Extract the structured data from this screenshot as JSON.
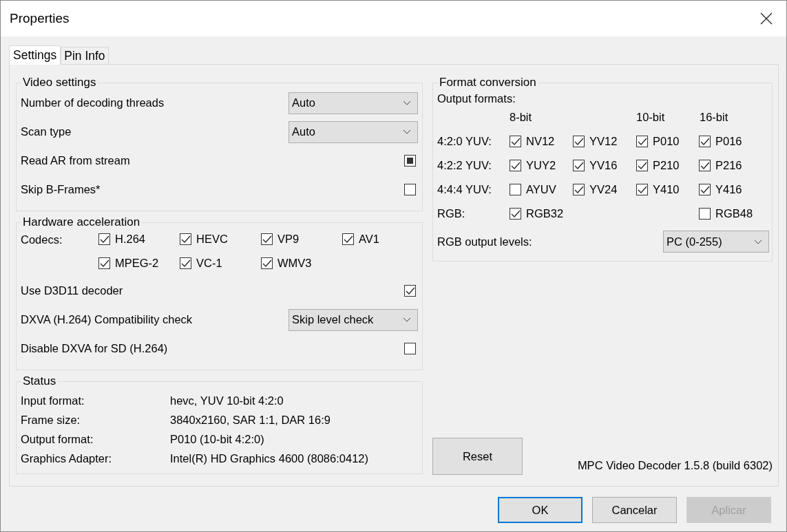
{
  "window": {
    "title": "Properties"
  },
  "tabs": [
    {
      "label": "Settings",
      "selected": true
    },
    {
      "label": "Pin Info",
      "selected": false
    }
  ],
  "video_settings": {
    "title": "Video settings",
    "rows": [
      {
        "kind": "dropdown",
        "label": "Number of decoding threads",
        "value": "Auto"
      },
      {
        "kind": "dropdown",
        "label": "Scan type",
        "value": "Auto"
      },
      {
        "kind": "checkbox",
        "label": "Read AR from stream",
        "checked": false,
        "indeterminate": true
      },
      {
        "kind": "checkbox",
        "label": "Skip B-Frames*",
        "checked": false,
        "indeterminate": false
      }
    ]
  },
  "hardware_acceleration": {
    "title": "Hardware acceleration",
    "codecs_label": "Codecs:",
    "codecs": [
      {
        "label": "H.264",
        "checked": true
      },
      {
        "label": "HEVC",
        "checked": true
      },
      {
        "label": "VP9",
        "checked": true
      },
      {
        "label": "AV1",
        "checked": true
      },
      {
        "label": "MPEG-2",
        "checked": true
      },
      {
        "label": "VC-1",
        "checked": true
      },
      {
        "label": "WMV3",
        "checked": true
      }
    ],
    "rows": [
      {
        "kind": "checkbox",
        "label": "Use D3D11 decoder",
        "checked": true
      },
      {
        "kind": "dropdown",
        "label": "DXVA (H.264) Compatibility check",
        "value": "Skip level check"
      },
      {
        "kind": "checkbox",
        "label": "Disable DXVA for SD (H.264)",
        "checked": false
      }
    ]
  },
  "status": {
    "title": "Status",
    "rows": [
      {
        "label": "Input format:",
        "value": "hevc, YUV 10-bit 4:2:0"
      },
      {
        "label": "Frame size:",
        "value": "3840x2160, SAR 1:1, DAR 16:9"
      },
      {
        "label": "Output format:",
        "value": "P010 (10-bit 4:2:0)"
      },
      {
        "label": "Graphics Adapter:",
        "value": "Intel(R) HD Graphics 4600 (8086:0412)"
      }
    ]
  },
  "format_conversion": {
    "title": "Format conversion",
    "output_formats_label": "Output formats:",
    "column_headers": [
      "8-bit",
      "10-bit",
      "16-bit"
    ],
    "rows": [
      {
        "label": "4:2:0 YUV:",
        "cells": [
          {
            "label": "NV12",
            "checked": true
          },
          {
            "label": "YV12",
            "checked": true
          },
          {
            "label": "P010",
            "checked": true
          },
          {
            "label": "P016",
            "checked": true
          }
        ]
      },
      {
        "label": "4:2:2 YUV:",
        "cells": [
          {
            "label": "YUY2",
            "checked": true
          },
          {
            "label": "YV16",
            "checked": true
          },
          {
            "label": "P210",
            "checked": true
          },
          {
            "label": "P216",
            "checked": true
          }
        ]
      },
      {
        "label": "4:4:4 YUV:",
        "cells": [
          {
            "label": "AYUV",
            "checked": false
          },
          {
            "label": "YV24",
            "checked": true
          },
          {
            "label": "Y410",
            "checked": true
          },
          {
            "label": "Y416",
            "checked": true
          }
        ]
      },
      {
        "label": "RGB:",
        "cells": [
          {
            "label": "RGB32",
            "checked": true
          },
          null,
          null,
          {
            "label": "RGB48",
            "checked": false
          }
        ]
      }
    ],
    "rgb_levels_label": "RGB output levels:",
    "rgb_levels_value": "PC (0-255)"
  },
  "reset_button": "Reset",
  "version": "MPC Video Decoder 1.5.8 (build 6302)",
  "buttons": [
    {
      "label": "OK",
      "disabled": false,
      "default": true
    },
    {
      "label": "Cancelar",
      "disabled": false,
      "default": false
    },
    {
      "label": "Aplicar",
      "disabled": true,
      "default": false
    }
  ]
}
